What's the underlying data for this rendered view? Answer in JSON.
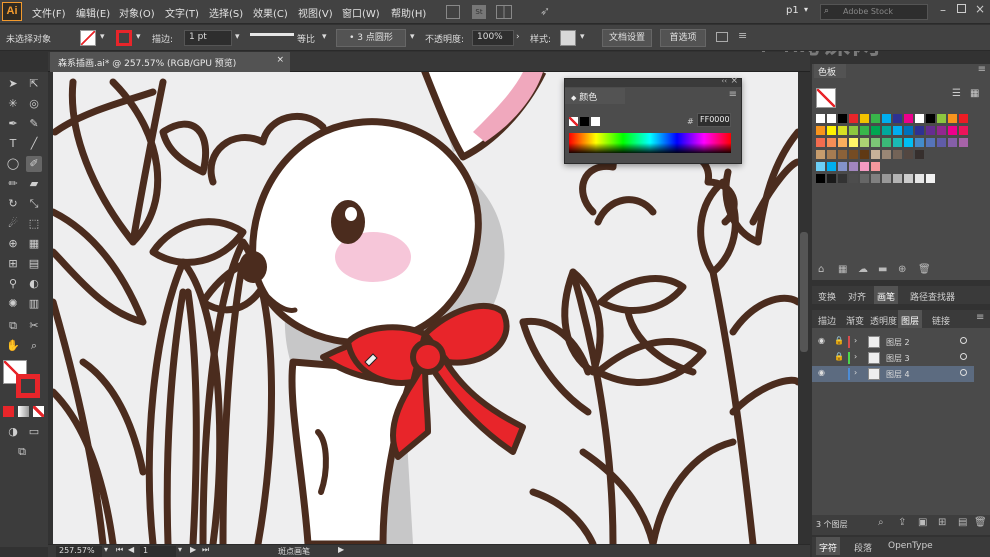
{
  "app": {
    "logo": "Ai"
  },
  "menu": [
    "文件(F)",
    "编辑(E)",
    "对象(O)",
    "文字(T)",
    "选择(S)",
    "效果(C)",
    "视图(V)",
    "窗口(W)",
    "帮助(H)"
  ],
  "menu_right": {
    "workspace": "p1",
    "search_placeholder": "Adobe Stock"
  },
  "control": {
    "selection": "未选择对象",
    "stroke_label": "描边:",
    "stroke_value": "1 pt",
    "stroke_style": "等比",
    "brush": "3 点圆形",
    "opacity_label": "不透明度:",
    "opacity_value": "100%",
    "style_label": "样式:",
    "doc_setup": "文档设置",
    "preferences": "首选项"
  },
  "document_tab": {
    "title": "森系插画.ai* @ 257.57% (RGB/GPU 预览)"
  },
  "status": {
    "zoom": "257.57%",
    "artboard": "1",
    "tool": "斑点画笔"
  },
  "color_panel": {
    "title": "颜色",
    "hex_label": "#",
    "hex_value": "FF0000"
  },
  "swatches_panel": {
    "title": "色板"
  },
  "panel_tabs_1": [
    "变换",
    "对齐",
    "画笔",
    "路径查找器"
  ],
  "panel_tabs_1_active": "画笔",
  "panel_tabs_2": [
    "描边",
    "渐变",
    "透明度",
    "图层",
    "链接"
  ],
  "panel_tabs_2_active": "图层",
  "layers": [
    {
      "name": "图层 2",
      "locked": true,
      "visible": true,
      "color": "#d64c4c",
      "selected": false
    },
    {
      "name": "图层 3",
      "locked": true,
      "visible": false,
      "color": "#4cd64c",
      "selected": false
    },
    {
      "name": "图层 4",
      "locked": false,
      "visible": true,
      "color": "#4c8cd6",
      "selected": true
    }
  ],
  "layers_footer": "3 个图层",
  "bottom_tabs": [
    "字符",
    "段落",
    "OpenType"
  ],
  "bottom_tabs_active": "字符",
  "watermark": "虎课网",
  "colors": {
    "accent": "#f29a2e",
    "fill": "#e8252a",
    "outline": "#4b2c1e",
    "canvas": "#eeeeef"
  }
}
